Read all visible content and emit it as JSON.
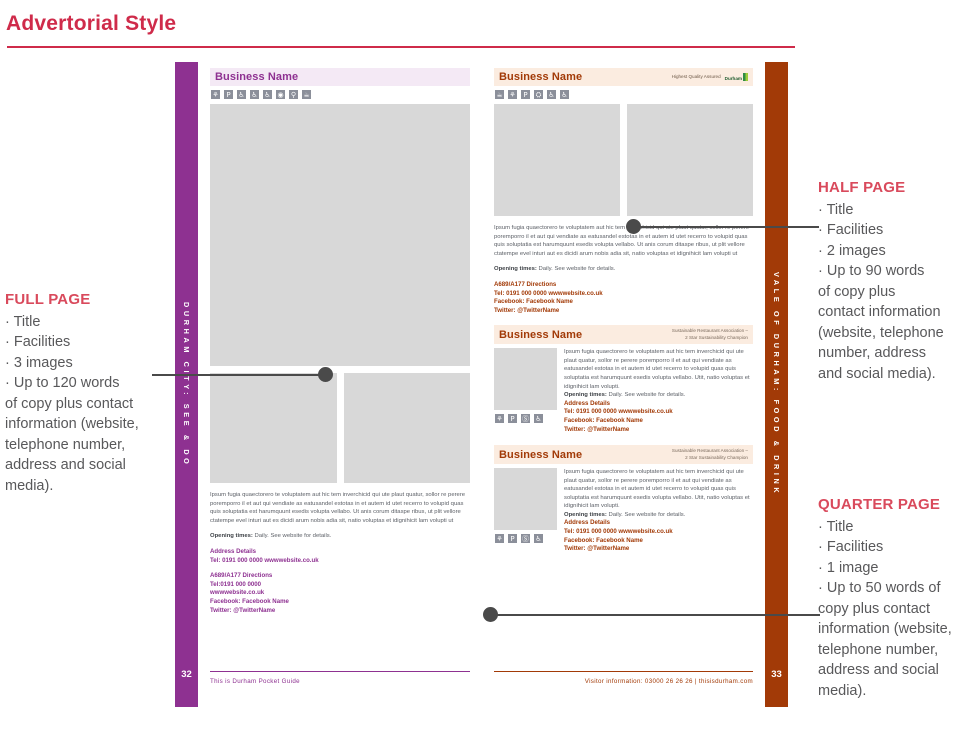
{
  "page": {
    "title": "Advertorial Style"
  },
  "annotations": {
    "full": {
      "heading": "FULL PAGE",
      "lines": [
        "· Title",
        "· Facilities",
        "· 3 images",
        "· Up to 120 words",
        "of copy plus contact",
        "information (website,",
        "telephone number,",
        "address and social",
        "media)."
      ]
    },
    "half": {
      "heading": "HALF PAGE",
      "lines": [
        "· Title",
        "· Facilities",
        "· 2 images",
        "· Up to 90 words",
        "of copy plus",
        "contact information",
        "(website, telephone",
        "number, address",
        "and social media)."
      ]
    },
    "quarter": {
      "heading": "QUARTER PAGE",
      "lines": [
        "· Title",
        "· Facilities",
        "· 1 image",
        "· Up to 50 words of",
        "copy plus contact",
        "information (website,",
        "telephone number,",
        "address and social",
        "media)."
      ]
    }
  },
  "spread": {
    "left_page": {
      "spine_text": "DURHAM CITY: SEE & DO",
      "spine_color": "#8e3191",
      "page_number": "32",
      "footer_text": "This is Durham Pocket Guide",
      "advert": {
        "business_name": "Business Name",
        "facilities": [
          "accessible-toilet-icon",
          "parking-icon",
          "assisted-wheelchair-icon",
          "wheelchair-access-icon",
          "level-access-icon",
          "hearing-loop-icon",
          "guide-dog-icon",
          "refreshments-icon"
        ],
        "body": "Ipsum fugia quaectorero te voluptatem aut hic tem inverchicid qui ute plaut quatur, sollor re perere poremporro il et aut qui vendiate as eatusandel estotas in et autem id utet recerro to volupid quas quis soluptatia est harumquunt esedis volupta vellabo. Ut anis corum ditaspe ribus, ut plit vellore ctatempe evel inturi aut es dicidi arum nobis adia sit, natio voluptas et idignihicit lam volupti ut",
        "opening_label": "Opening times:",
        "opening_value": "Daily. See website for details.",
        "contact_block_1": [
          "Address Details",
          "Tel: 0191 000 0000   wwwwebsite.co.uk"
        ],
        "contact_block_2": [
          "A689/A177 Directions",
          "Tel:0191 000 0000",
          "wwwwebsite.co.uk",
          "Facebook: Facebook Name",
          "Twitter: @TwitterName"
        ]
      }
    },
    "right_page": {
      "spine_text": "VALE OF DURHAM: FOOD & DRINK",
      "spine_color": "#a23a07",
      "page_number": "33",
      "footer_text": "Visitor information: 03000 26 26 26  |  thisisdurham.com",
      "half_advert": {
        "business_name": "Business Name",
        "quality_badge": "Highest Quality Assured",
        "logo_word": "Durham",
        "facilities": [
          "refreshments-icon",
          "accessible-toilet-icon",
          "parking-icon",
          "picnic-icon",
          "wheelchair-access-icon",
          "assisted-wheelchair-icon"
        ],
        "body": "Ipsum fugia quaectorero te voluptatem aut hic tem inverchicid qui ute plaut quatur, sollor re perere poremporro il et aut qui vendiate as eatusandel estotas in et autem id utet recerro to volupid quas quis soluptatia est harumquunt esedis volupta vellabo. Ut anis corum ditaspe ribus, ut plit vellore ctatempe evel inturi aut es dicidi arum nobis adia sit, natio voluptas et idignihicit lam volupti ut",
        "opening_label": "Opening times:",
        "opening_value": "Daily. See website for details.",
        "contact_block": [
          "A689/A177 Directions",
          "Tel: 0191 000 0000   wwwwebsite.co.uk",
          "Facebook: Facebook Name",
          "Twitter: @TwitterName"
        ]
      },
      "quarter_advert_1": {
        "business_name": "Business Name",
        "award": "Sustainable Restaurant Association –\n2 Star Sustainability Champion",
        "facilities": [
          "accessible-toilet-icon",
          "parking-icon",
          "no-dogs-icon",
          "wheelchair-access-icon"
        ],
        "body": "Ipsum fugia quaectorero te voluptatem aut hic tem inverchicid qui ute plaut quatur, sollor re perere poremporro il et aut qui vendiate as eatusandel estotas in et autem id utet recerro to volupid quas quis soluptatia est harumquunt esedis volupta vellabo. Utit, natio voluptas et idignihicit lam volupti.",
        "opening_label": "Opening times:",
        "opening_value": "Daily. See website for details.",
        "contact_block": [
          "Address Details",
          "Tel: 0191 000 0000   wwwwebsite.co.uk",
          "Facebook: Facebook Name",
          "Twitter: @TwitterName"
        ]
      },
      "quarter_advert_2": {
        "business_name": "Business Name",
        "award": "Sustainable Restaurant Association –\n2 Star Sustainability Champion",
        "facilities": [
          "accessible-toilet-icon",
          "parking-icon",
          "no-dogs-icon",
          "wheelchair-access-icon"
        ],
        "body": "Ipsum fugia quaectorero te voluptatem aut hic tem inverchicid qui ute plaut quatur, sollor re perere poremporro il et aut qui vendiate as eatusandel estotas in et autem id utet recerro to volupid quas quis soluptatia est harumquunt esedis volupta vellabo. Utit, natio voluptas et idignihicit lam volupti.",
        "opening_label": "Opening times:",
        "opening_value": "Daily. See website for details.",
        "contact_block": [
          "Address Details",
          "Tel: 0191 000 0000   wwwwebsite.co.uk",
          "Facebook: Facebook Name",
          "Twitter: @TwitterName"
        ]
      }
    }
  },
  "colors": {
    "accent_red": "#cf2b4a",
    "purple": "#8e3191",
    "orange": "#a23a07",
    "body_grey": "#58585a"
  }
}
